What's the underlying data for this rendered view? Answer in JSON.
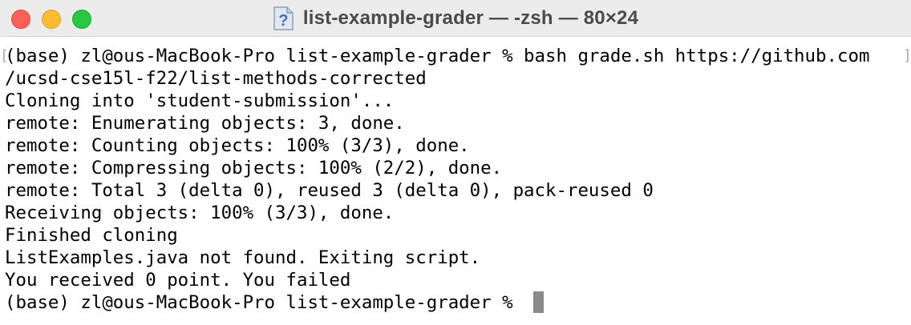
{
  "window": {
    "title": "list-example-grader — -zsh — 80×24",
    "title_icon": "terminal-document-question-icon"
  },
  "terminal": {
    "lines": [
      "(base) zl@ous-MacBook-Pro list-example-grader % bash grade.sh https://github.com",
      "/ucsd-cse15l-f22/list-methods-corrected",
      "Cloning into 'student-submission'...",
      "remote: Enumerating objects: 3, done.",
      "remote: Counting objects: 100% (3/3), done.",
      "remote: Compressing objects: 100% (2/2), done.",
      "remote: Total 3 (delta 0), reused 3 (delta 0), pack-reused 0",
      "Receiving objects: 100% (3/3), done.",
      "Finished cloning",
      "ListExamples.java not found. Exiting script.",
      "You received 0 point. You failed"
    ],
    "prompt": "(base) zl@ous-MacBook-Pro list-example-grader % "
  },
  "colors": {
    "close": "#fe5f57",
    "minimize": "#febc2e",
    "zoom": "#28c840",
    "text": "#000000",
    "cursor": "#8a8a8a"
  }
}
